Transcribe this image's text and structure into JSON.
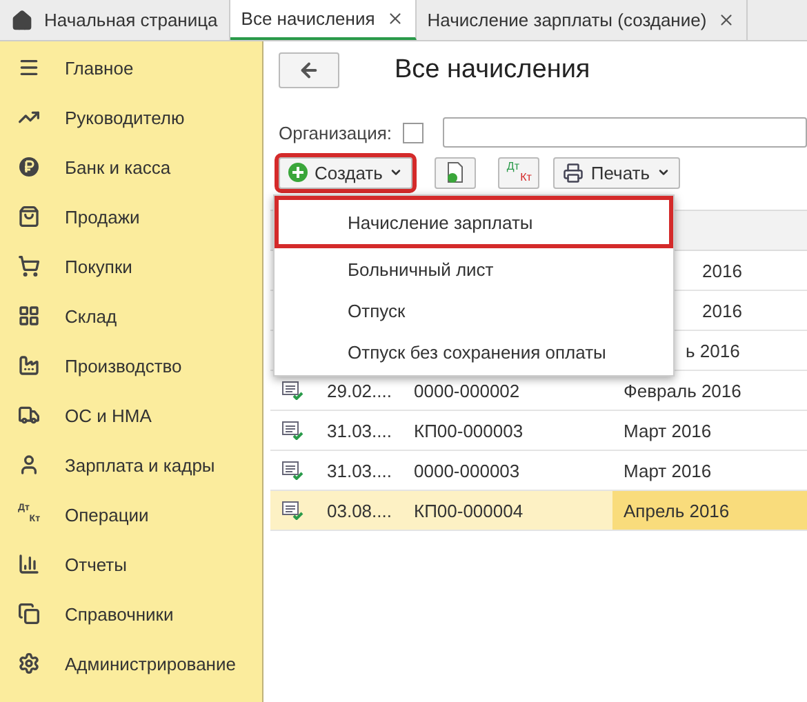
{
  "tabs": [
    {
      "label": "Начальная страница",
      "kind": "home",
      "closable": false,
      "selected": false
    },
    {
      "label": "Все начисления",
      "kind": "doc",
      "closable": true,
      "selected": true
    },
    {
      "label": "Начисление зарплаты (создание)",
      "kind": "doc",
      "closable": true,
      "selected": false
    }
  ],
  "sidebar": {
    "items": [
      {
        "label": "Главное",
        "kind": "menu"
      },
      {
        "label": "Руководителю",
        "kind": "trend"
      },
      {
        "label": "Банк и касса",
        "kind": "ruble"
      },
      {
        "label": "Продажи",
        "kind": "bag"
      },
      {
        "label": "Покупки",
        "kind": "cart"
      },
      {
        "label": "Склад",
        "kind": "grid"
      },
      {
        "label": "Производство",
        "kind": "factory"
      },
      {
        "label": "ОС и НМА",
        "kind": "truck"
      },
      {
        "label": "Зарплата и кадры",
        "kind": "user"
      },
      {
        "label": "Операции",
        "kind": "dtkt",
        "top": "Дт",
        "bottom": "Кт"
      },
      {
        "label": "Отчеты",
        "kind": "chart"
      },
      {
        "label": "Справочники",
        "kind": "books"
      },
      {
        "label": "Администрирование",
        "kind": "gear"
      }
    ]
  },
  "title": "Все начисления",
  "filter": {
    "label": "Организация:",
    "checked": false
  },
  "toolbar": {
    "create": "Создать",
    "dt": "Дт",
    "kt": "Кт",
    "print": "Печать"
  },
  "menu": [
    {
      "label": "Начисление зарплаты",
      "selected": true
    },
    {
      "label": "Больничный лист",
      "selected": false
    },
    {
      "label": "Отпуск",
      "selected": false
    },
    {
      "label": "Отпуск без сохранения оплаты",
      "selected": false
    }
  ],
  "rows": [
    {
      "hidden": true,
      "month": "2016",
      "selected": false
    },
    {
      "hidden": true,
      "month": "2016",
      "selected": false
    },
    {
      "hidden": true,
      "month": "ь 2016",
      "selected": false
    },
    {
      "hidden": false,
      "date": "29.02....",
      "number": "0000-000002",
      "month": "Февраль 2016",
      "selected": false
    },
    {
      "hidden": false,
      "date": "31.03....",
      "number": "КП00-000003",
      "month": "Март 2016",
      "selected": false
    },
    {
      "hidden": false,
      "date": "31.03....",
      "number": "0000-000003",
      "month": "Март 2016",
      "selected": false
    },
    {
      "hidden": false,
      "date": "03.08....",
      "number": "КП00-000004",
      "month": "Апрель 2016",
      "selected": true
    }
  ]
}
